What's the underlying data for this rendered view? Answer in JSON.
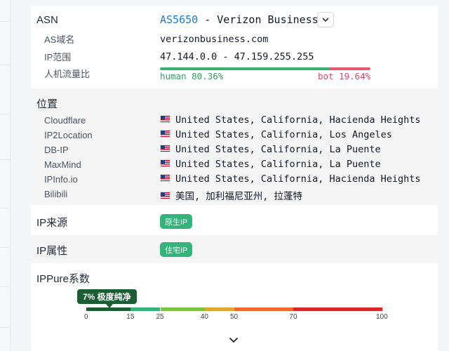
{
  "asn": {
    "label": "ASN",
    "number": "AS5650",
    "separator": " - ",
    "org": "Verizon Business",
    "toggle_icon": "chevron-down-icon",
    "fields": [
      {
        "label": "AS域名",
        "value": "verizonbusiness.com"
      },
      {
        "label": "IP范围",
        "value": "47.144.0.0 - 47.159.255.255"
      }
    ],
    "traffic": {
      "label": "人机流量比",
      "human_label": "human 80.36%",
      "bot_label": "bot 19.64%",
      "human_percent": 80.36,
      "bot_percent": 19.64,
      "human_color": "#3aaf6d",
      "bot_color": "#e8566d"
    }
  },
  "location": {
    "label": "位置",
    "rows": [
      {
        "source": "Cloudflare",
        "value": "United States, California, Hacienda Heights"
      },
      {
        "source": "IP2Location",
        "value": "United States, California, Los Angeles"
      },
      {
        "source": "DB-IP",
        "value": "United States, California, La Puente"
      },
      {
        "source": "MaxMind",
        "value": "United States, California, La Puente"
      },
      {
        "source": "IPInfo.io",
        "value": "United States, California, Hacienda Heights"
      },
      {
        "source": "Bilibili",
        "value": "美国, 加利福尼亚州, 拉蓬特"
      }
    ],
    "flag_icon": "us-flag-icon"
  },
  "ip_source": {
    "label": "IP来源",
    "tag": "原生IP"
  },
  "ip_type": {
    "label": "IP属性",
    "tag": "住宅IP"
  },
  "ippure": {
    "label": "IPPure系数",
    "badge": "7% 极度纯净",
    "value_percent": 7,
    "ticks": [
      "0",
      "15",
      "25",
      "40",
      "50",
      "70",
      "100"
    ],
    "colors": [
      "#1b5e33",
      "#34b37a",
      "#7cc242",
      "#e0a82e",
      "#ef6a2a",
      "#d62828"
    ]
  },
  "footer": {
    "expand_icon": "chevron-down-icon"
  },
  "accent_tag_color": "#34b37a",
  "link_color": "#1e7bc8"
}
